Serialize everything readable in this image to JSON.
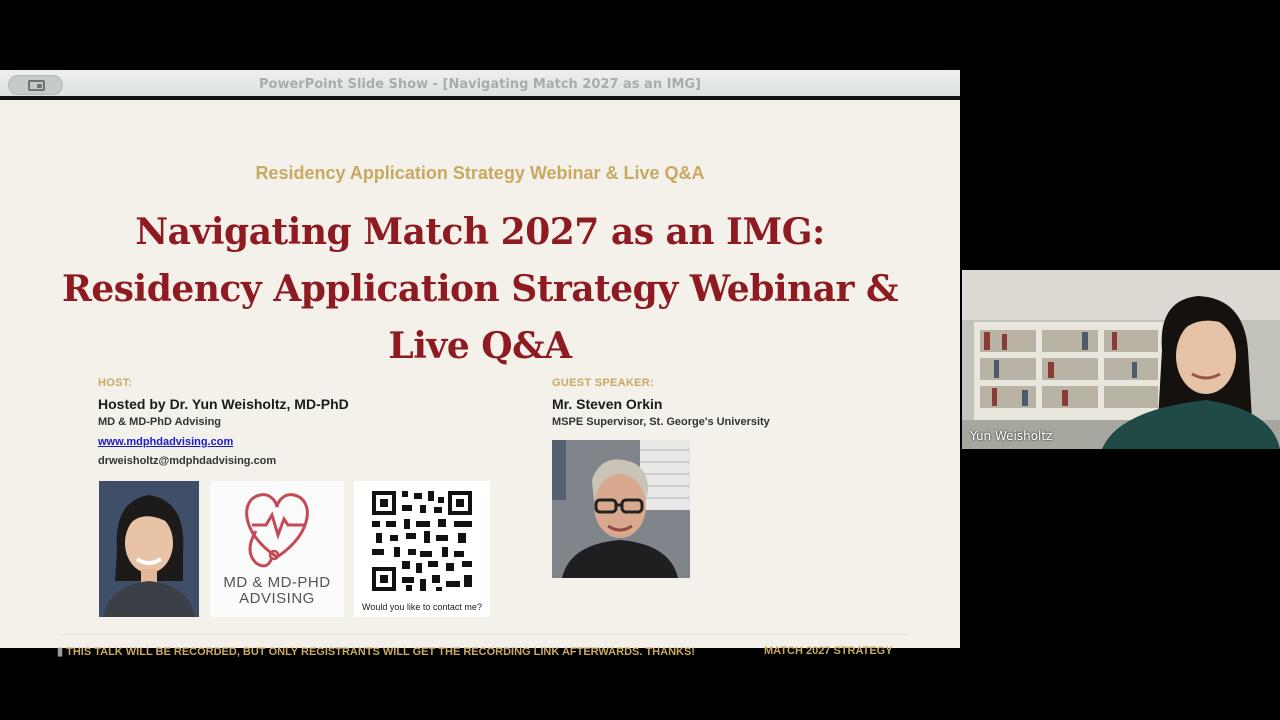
{
  "window": {
    "title": "PowerPoint Slide Show - [Navigating Match 2027 as an IMG]",
    "view_toggle_icon": "presenter-view-icon"
  },
  "slide": {
    "kicker": "Residency Application Strategy Webinar & Live Q&A",
    "title": "Navigating Match 2027 as an IMG: Residency Application Strategy Webinar & Live Q&A",
    "host": {
      "label": "HOST:",
      "name": "Hosted by Dr. Yun Weisholtz, MD-PhD",
      "org": "MD & MD-PhD Advising",
      "website": "www.mdphdadvising.com",
      "email": "drweisholtz@mdphdadvising.com"
    },
    "logo": {
      "line1": "MD & MD-PHD",
      "line2": "ADVISING"
    },
    "qr_caption": "Would you like to contact me?",
    "guest": {
      "label": "GUEST SPEAKER:",
      "name": "Mr. Steven Orkin",
      "role": "MSPE Supervisor, St. George's University"
    },
    "footer_note": "THIS TALK WILL BE RECORDED, BUT ONLY REGISTRANTS WILL GET THE RECORDING LINK AFTERWARDS. THANKS!",
    "footer_right": "MATCH 2027 STRATEGY"
  },
  "participant": {
    "name": "Yun Weisholtz"
  },
  "colors": {
    "title": "#8e1b22",
    "gold": "#c9a862",
    "link": "#1a1ad0",
    "logo_red": "#c44a55"
  }
}
